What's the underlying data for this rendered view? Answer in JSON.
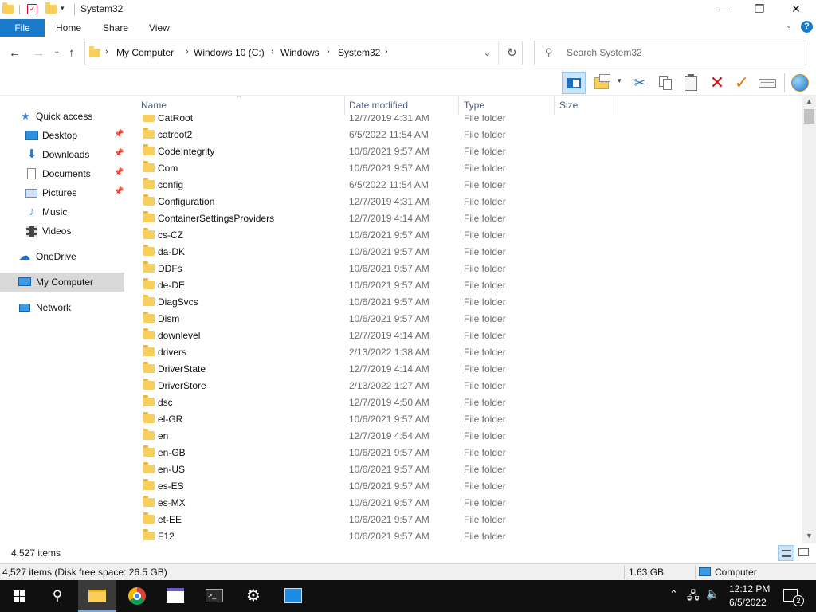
{
  "window": {
    "title": "System32",
    "buttons": {
      "minimize": "—",
      "maximize": "❐",
      "close": "✕"
    }
  },
  "ribbon": {
    "tabs": [
      "File",
      "Home",
      "Share",
      "View"
    ]
  },
  "address": {
    "crumbs": [
      "My Computer",
      "Windows 10 (C:)",
      "Windows",
      "System32"
    ],
    "search_placeholder": "Search System32"
  },
  "nav": {
    "items": [
      {
        "label": "Quick access",
        "icon": "star-icon"
      },
      {
        "label": "Desktop",
        "icon": "desktop-icon",
        "pinned": true
      },
      {
        "label": "Downloads",
        "icon": "download-arrow-icon",
        "pinned": true
      },
      {
        "label": "Documents",
        "icon": "document-icon",
        "pinned": true
      },
      {
        "label": "Pictures",
        "icon": "pictures-icon",
        "pinned": true
      },
      {
        "label": "Music",
        "icon": "music-note-icon"
      },
      {
        "label": "Videos",
        "icon": "film-icon"
      },
      {
        "label": "OneDrive",
        "icon": "cloud-icon"
      },
      {
        "label": "My Computer",
        "icon": "computer-icon",
        "selected": true
      },
      {
        "label": "Network",
        "icon": "network-icon"
      }
    ]
  },
  "columns": {
    "name": "Name",
    "date": "Date modified",
    "type": "Type",
    "size": "Size"
  },
  "files": [
    {
      "name": "CatRoot",
      "date": "12/7/2019 4:31 AM",
      "type": "File folder"
    },
    {
      "name": "catroot2",
      "date": "6/5/2022 11:54 AM",
      "type": "File folder"
    },
    {
      "name": "CodeIntegrity",
      "date": "10/6/2021 9:57 AM",
      "type": "File folder"
    },
    {
      "name": "Com",
      "date": "10/6/2021 9:57 AM",
      "type": "File folder"
    },
    {
      "name": "config",
      "date": "6/5/2022 11:54 AM",
      "type": "File folder"
    },
    {
      "name": "Configuration",
      "date": "12/7/2019 4:31 AM",
      "type": "File folder"
    },
    {
      "name": "ContainerSettingsProviders",
      "date": "12/7/2019 4:14 AM",
      "type": "File folder"
    },
    {
      "name": "cs-CZ",
      "date": "10/6/2021 9:57 AM",
      "type": "File folder"
    },
    {
      "name": "da-DK",
      "date": "10/6/2021 9:57 AM",
      "type": "File folder"
    },
    {
      "name": "DDFs",
      "date": "10/6/2021 9:57 AM",
      "type": "File folder"
    },
    {
      "name": "de-DE",
      "date": "10/6/2021 9:57 AM",
      "type": "File folder"
    },
    {
      "name": "DiagSvcs",
      "date": "10/6/2021 9:57 AM",
      "type": "File folder"
    },
    {
      "name": "Dism",
      "date": "10/6/2021 9:57 AM",
      "type": "File folder"
    },
    {
      "name": "downlevel",
      "date": "12/7/2019 4:14 AM",
      "type": "File folder"
    },
    {
      "name": "drivers",
      "date": "2/13/2022 1:38 AM",
      "type": "File folder"
    },
    {
      "name": "DriverState",
      "date": "12/7/2019 4:14 AM",
      "type": "File folder"
    },
    {
      "name": "DriverStore",
      "date": "2/13/2022 1:27 AM",
      "type": "File folder"
    },
    {
      "name": "dsc",
      "date": "12/7/2019 4:50 AM",
      "type": "File folder"
    },
    {
      "name": "el-GR",
      "date": "10/6/2021 9:57 AM",
      "type": "File folder"
    },
    {
      "name": "en",
      "date": "12/7/2019 4:54 AM",
      "type": "File folder"
    },
    {
      "name": "en-GB",
      "date": "10/6/2021 9:57 AM",
      "type": "File folder"
    },
    {
      "name": "en-US",
      "date": "10/6/2021 9:57 AM",
      "type": "File folder"
    },
    {
      "name": "es-ES",
      "date": "10/6/2021 9:57 AM",
      "type": "File folder"
    },
    {
      "name": "es-MX",
      "date": "10/6/2021 9:57 AM",
      "type": "File folder"
    },
    {
      "name": "et-EE",
      "date": "10/6/2021 9:57 AM",
      "type": "File folder"
    },
    {
      "name": "F12",
      "date": "10/6/2021 9:57 AM",
      "type": "File folder"
    }
  ],
  "footer": {
    "item_count": "4,527 items"
  },
  "statusbar": {
    "summary": "4,527 items (Disk free space: 26.5 GB)",
    "size": "1.63 GB",
    "location": "Computer"
  },
  "taskbar": {
    "time": "12:12 PM",
    "date": "6/5/2022",
    "notification_count": "2"
  },
  "colors": {
    "accent": "#1979ca",
    "folder": "#f8cf5a",
    "selected_nav": "#d9d9d9",
    "taskbar": "#101010"
  }
}
